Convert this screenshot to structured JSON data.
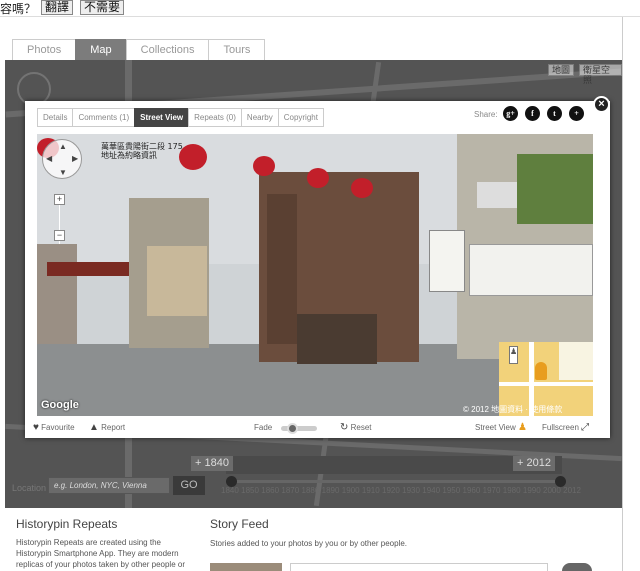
{
  "translate_bar": {
    "question": "容嗎？",
    "translate_label": "翻譯",
    "decline_label": "不需要"
  },
  "main_tabs": [
    {
      "label": "Photos"
    },
    {
      "label": "Map"
    },
    {
      "label": "Collections"
    },
    {
      "label": "Tours"
    }
  ],
  "map": {
    "map_type_buttons": [
      "地圖",
      "衛星空照"
    ]
  },
  "timeline": {
    "start_year": "1840",
    "end_year": "2012",
    "start_prefix": "+",
    "end_prefix": "+",
    "years": [
      "1840",
      "1850",
      "1860",
      "1870",
      "1880",
      "1890",
      "1900",
      "1910",
      "1920",
      "1930",
      "1940",
      "1950",
      "1960",
      "1970",
      "1980",
      "1990",
      "2000",
      "2012"
    ],
    "location_label": "Location",
    "location_placeholder": "e.g. London, NYC, Vienna",
    "go_label": "GO"
  },
  "modal": {
    "close_label": "×",
    "tabs": [
      {
        "label": "Details"
      },
      {
        "label": "Comments (1)"
      },
      {
        "label": "Street View"
      },
      {
        "label": "Repeats (0)"
      },
      {
        "label": "Nearby"
      },
      {
        "label": "Copyright"
      }
    ],
    "share_label": "Share:",
    "share_icons": [
      {
        "name": "google-plus-icon",
        "glyph": "g+"
      },
      {
        "name": "facebook-icon",
        "glyph": "f"
      },
      {
        "name": "twitter-icon",
        "glyph": "t"
      },
      {
        "name": "add-icon",
        "glyph": "+"
      }
    ],
    "street_view": {
      "address_line1": "萬華區貴陽街二段 175",
      "address_line2": "地址為約略資訊",
      "google_logo": "Google",
      "copyright": "© 2012",
      "map_attribution": "地圖資料 · 使用條款",
      "zoom_in": "+",
      "zoom_out": "−"
    },
    "footer": {
      "favourite_label": "Favourite",
      "report_label": "Report",
      "fade_label": "Fade",
      "reset_label": "Reset",
      "street_view_label": "Street View",
      "fullscreen_label": "Fullscreen"
    }
  },
  "repeats_section": {
    "title": "Historypin Repeats",
    "text": "Historypin Repeats are created using the Historypin Smartphone App. They are modern replicas of your photos taken by other people or modern replicas of"
  },
  "story_section": {
    "title": "Story Feed",
    "text": "Stories added to your photos by you or by other people."
  },
  "colors": {
    "active_tab": "#7c7c7c",
    "lantern_red": "#c21f2a",
    "map_dim": "#545454"
  }
}
